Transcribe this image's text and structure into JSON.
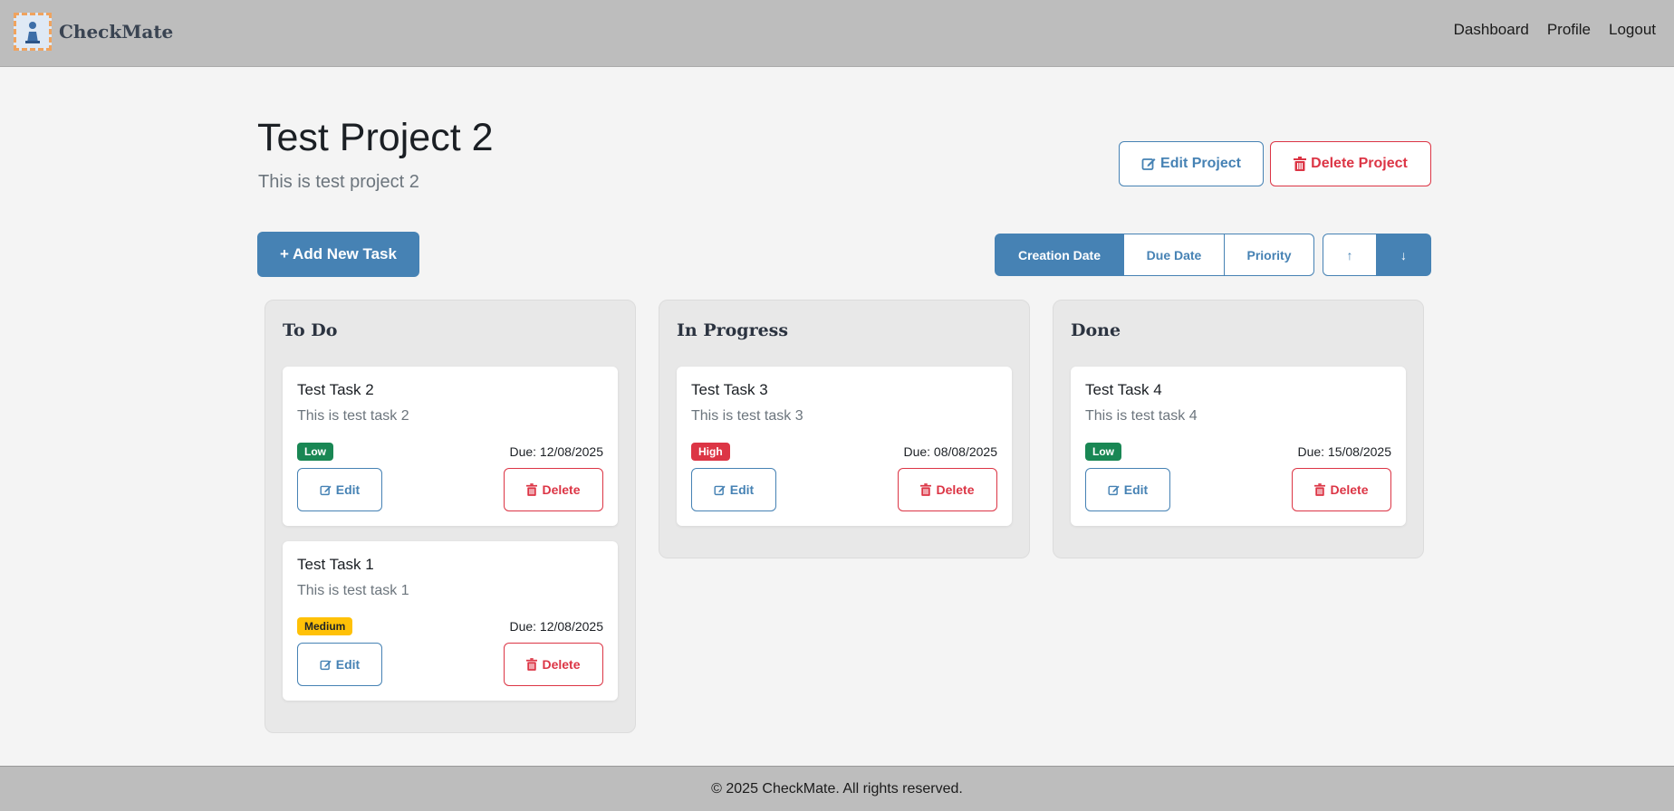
{
  "app": {
    "name": "CheckMate"
  },
  "nav": {
    "links": [
      "Dashboard",
      "Profile",
      "Logout"
    ]
  },
  "project": {
    "title": "Test Project 2",
    "description": "This is test project 2",
    "edit_label": "Edit Project",
    "delete_label": "Delete Project"
  },
  "toolbar": {
    "add_task_label": "+ Add New Task",
    "sort_options": [
      "Creation Date",
      "Due Date",
      "Priority"
    ],
    "active_sort": "Creation Date",
    "order_up": "↑",
    "order_down": "↓",
    "active_order": "down"
  },
  "columns": [
    {
      "title": "To Do",
      "tasks": [
        {
          "title": "Test Task 2",
          "description": "This is test task 2",
          "priority": "Low",
          "due": "Due: 12/08/2025",
          "edit_label": "Edit",
          "delete_label": "Delete"
        },
        {
          "title": "Test Task 1",
          "description": "This is test task 1",
          "priority": "Medium",
          "due": "Due: 12/08/2025",
          "edit_label": "Edit",
          "delete_label": "Delete"
        }
      ]
    },
    {
      "title": "In Progress",
      "tasks": [
        {
          "title": "Test Task 3",
          "description": "This is test task 3",
          "priority": "High",
          "due": "Due: 08/08/2025",
          "edit_label": "Edit",
          "delete_label": "Delete"
        }
      ]
    },
    {
      "title": "Done",
      "tasks": [
        {
          "title": "Test Task 4",
          "description": "This is test task 4",
          "priority": "Low",
          "due": "Due: 15/08/2025",
          "edit_label": "Edit",
          "delete_label": "Delete"
        }
      ]
    }
  ],
  "footer": {
    "text": "© 2025 CheckMate. All rights reserved."
  },
  "colors": {
    "primary": "#4682b4",
    "danger": "#dc3545",
    "low": "#198754",
    "medium": "#ffc107",
    "high": "#dc3545"
  }
}
